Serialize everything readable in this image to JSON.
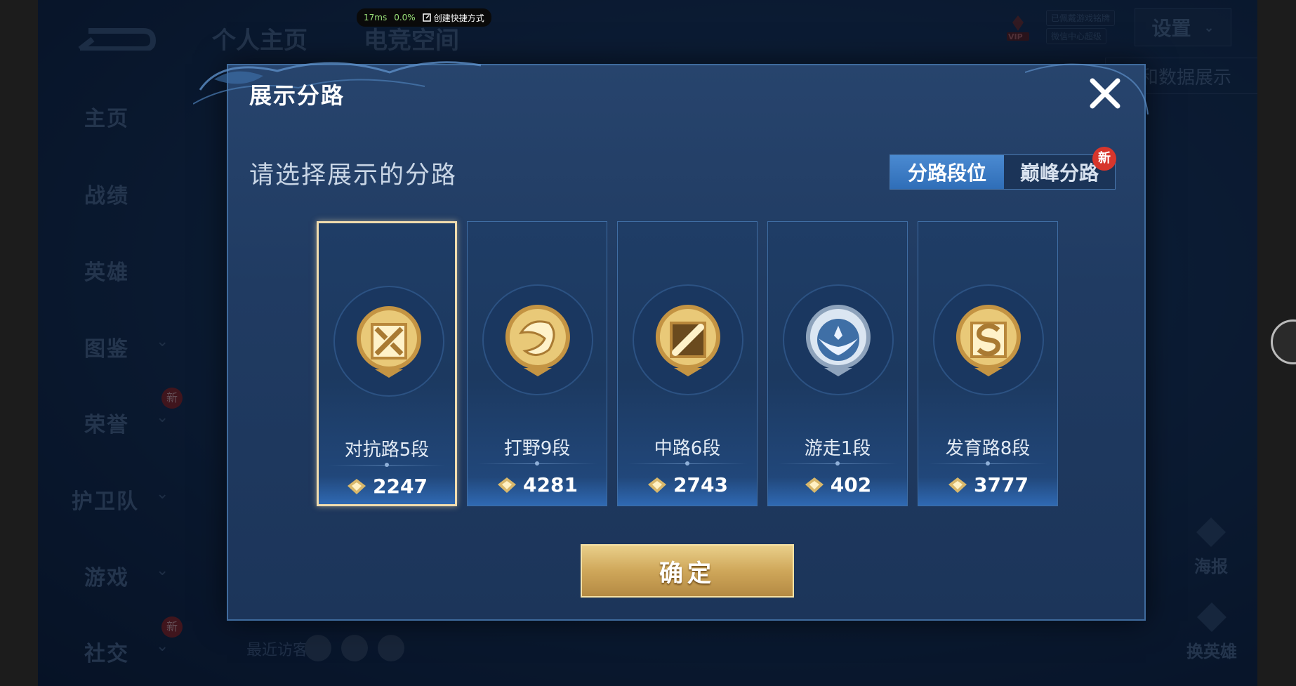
{
  "perf": {
    "ms": "17ms",
    "pct": "0.0%",
    "shortcut": "创建快捷方式"
  },
  "bg": {
    "tabs": [
      "个人主页",
      "电竞空间"
    ],
    "nav": [
      "主页",
      "战绩",
      "英雄",
      "图鉴",
      "荣誉",
      "护卫队",
      "游戏",
      "社交"
    ],
    "new_tag": "新",
    "settings": "设置",
    "vip": "VIP",
    "chip1": "已佩戴游戏铭牌",
    "chip2": "微信中心超级",
    "link": "和数据展示",
    "poster": "海报",
    "swap_hero": "换英雄",
    "visitors": "最近访客>"
  },
  "modal": {
    "title": "展示分路",
    "subtitle": "请选择展示的分路",
    "seg": [
      {
        "label": "分路段位",
        "active": true
      },
      {
        "label": "巅峰分路",
        "active": false
      }
    ],
    "seg_new": "新",
    "confirm": "确定",
    "cards": [
      {
        "name": "对抗路5段",
        "score": "2247",
        "selected": true,
        "emblem": "sword-emblem-icon",
        "tone": "gold"
      },
      {
        "name": "打野9段",
        "score": "4281",
        "selected": false,
        "emblem": "dragon-emblem-icon",
        "tone": "gold"
      },
      {
        "name": "中路6段",
        "score": "2743",
        "selected": false,
        "emblem": "wand-emblem-icon",
        "tone": "gold"
      },
      {
        "name": "游走1段",
        "score": "402",
        "selected": false,
        "emblem": "wings-emblem-icon",
        "tone": "silver"
      },
      {
        "name": "发育路8段",
        "score": "3777",
        "selected": false,
        "emblem": "bow-emblem-icon",
        "tone": "gold"
      }
    ]
  },
  "colors": {
    "gold": "#d9a84e",
    "silver": "#aebfd4",
    "accent": "#2f6eb8"
  }
}
